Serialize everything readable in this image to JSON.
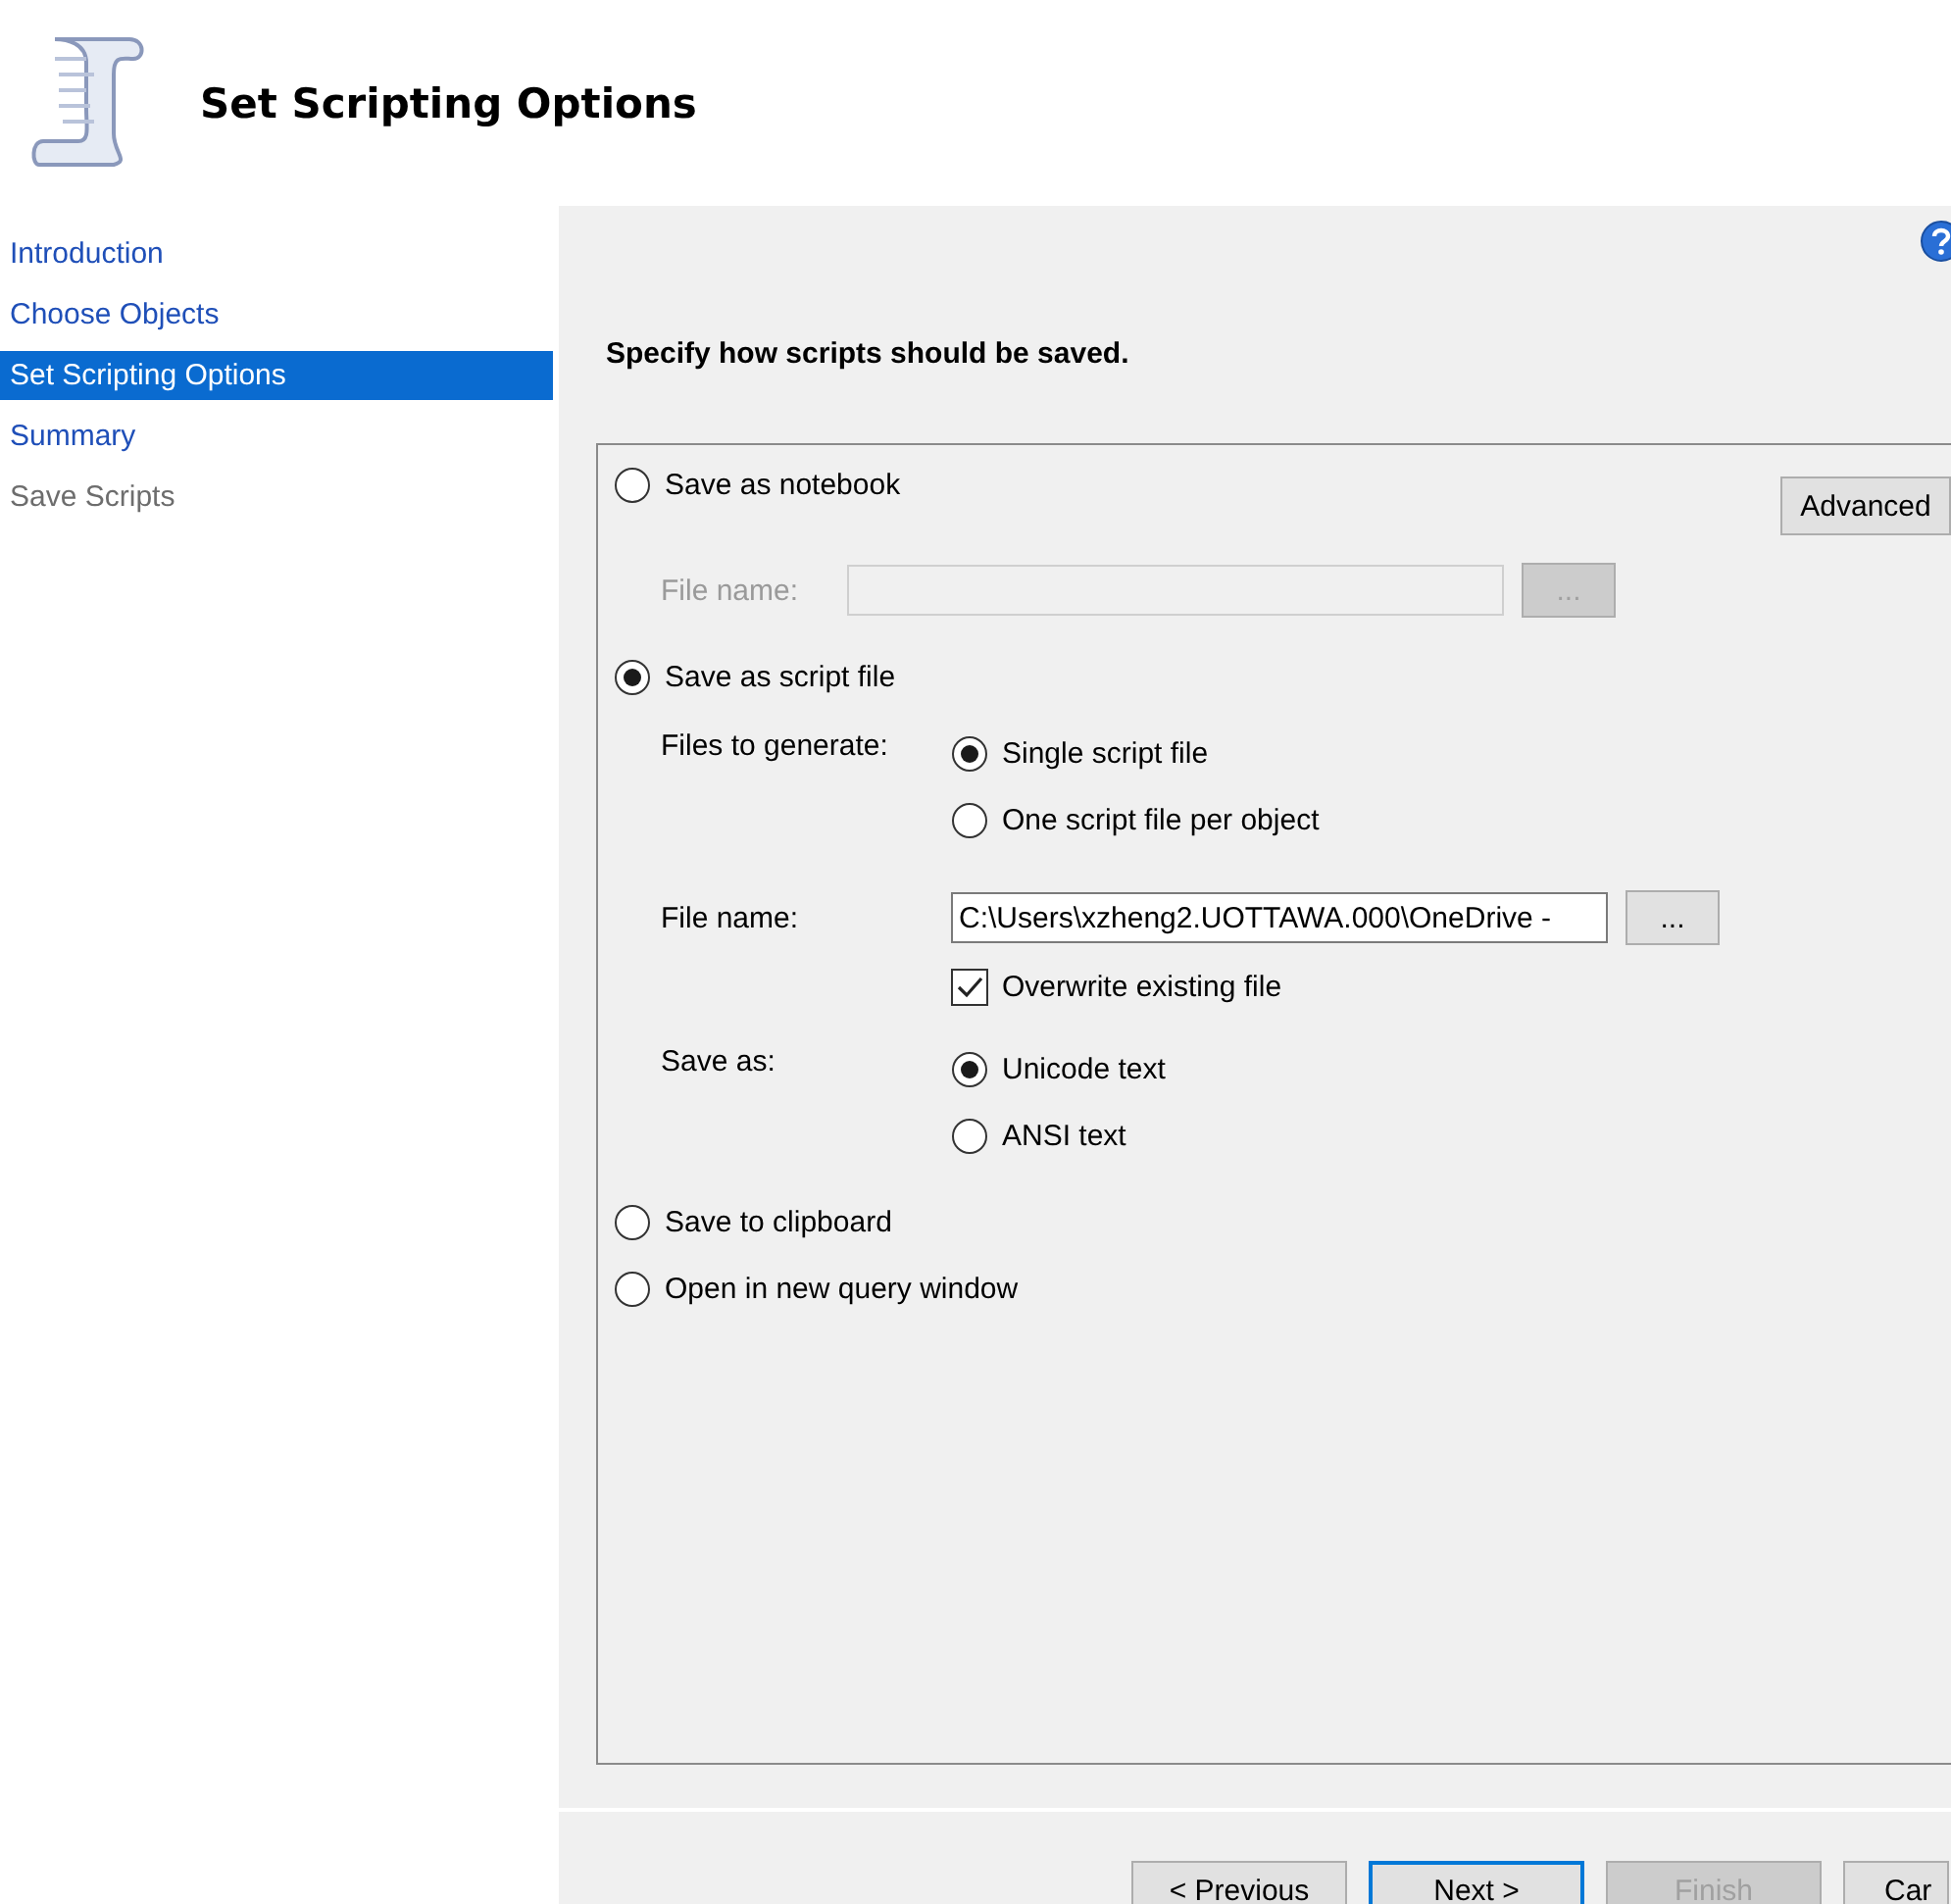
{
  "header": {
    "title": "Set Scripting Options"
  },
  "steps": [
    {
      "label": "Introduction",
      "selected": false,
      "disabled": false
    },
    {
      "label": "Choose Objects",
      "selected": false,
      "disabled": false
    },
    {
      "label": "Set Scripting Options",
      "selected": true,
      "disabled": false
    },
    {
      "label": "Summary",
      "selected": false,
      "disabled": false
    },
    {
      "label": "Save Scripts",
      "selected": false,
      "disabled": true
    }
  ],
  "instruction": "Specify how scripts should be saved.",
  "advanced_button": "Advanced",
  "save_modes": [
    {
      "kind": "notebook",
      "label": "Save as notebook",
      "selected": false,
      "file_name": {
        "label": "File name:",
        "browse": "...",
        "disabled": true
      }
    },
    {
      "kind": "script",
      "label": "Save as script file",
      "selected": true,
      "files_to_generate": {
        "label": "Files to generate:",
        "choices": [
          {
            "label": "Single script file",
            "selected": true
          },
          {
            "label": "One script file per object",
            "selected": false
          }
        ]
      },
      "file_name": {
        "label": "File name:",
        "value": "C:\\Users\\xzheng2.UOTTAWA.000\\OneDrive -",
        "browse": "...",
        "disabled": false
      },
      "overwrite": {
        "label": "Overwrite existing file",
        "checked": true
      },
      "save_as": {
        "label": "Save as:",
        "choices": [
          {
            "label": "Unicode text",
            "selected": true
          },
          {
            "label": "ANSI text",
            "selected": false
          }
        ]
      }
    },
    {
      "kind": "plain",
      "label": "Save to clipboard",
      "selected": false
    },
    {
      "kind": "plain",
      "label": "Open in new query window",
      "selected": false
    }
  ],
  "buttons": [
    {
      "label": "< Previous",
      "disabled": false,
      "focused": false
    },
    {
      "label": "Next >",
      "disabled": false,
      "focused": true
    },
    {
      "label": "Finish",
      "disabled": true,
      "focused": false
    },
    {
      "label": "Car",
      "disabled": false,
      "focused": false
    }
  ]
}
